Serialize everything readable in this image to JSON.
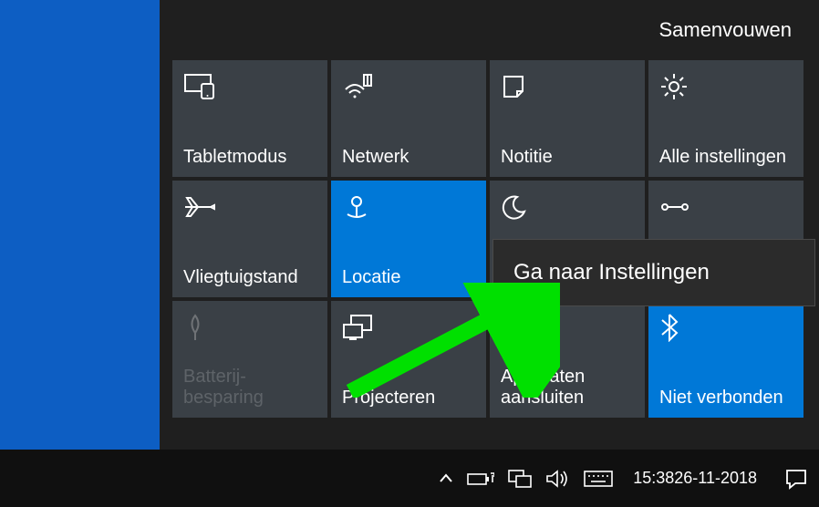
{
  "collapse_label": "Samenvouwen",
  "context_menu": {
    "label": "Ga naar Instellingen"
  },
  "tiles": {
    "tablet": {
      "label": "Tabletmodus"
    },
    "network": {
      "label": "Netwerk"
    },
    "note": {
      "label": "Notitie"
    },
    "settings": {
      "label": "Alle instellingen"
    },
    "airplane": {
      "label": "Vliegtuigstand"
    },
    "location": {
      "label": "Locatie"
    },
    "quiet": {
      "label": "Stille uren"
    },
    "vpn": {
      "label": "VPN"
    },
    "battery": {
      "label": "Batterij-\nbesparing"
    },
    "project": {
      "label": "Projecteren"
    },
    "connect": {
      "label": "Apparaten aansluiten"
    },
    "bluetooth": {
      "label": "Niet verbonden"
    }
  },
  "clock": {
    "time": "15:38",
    "date": "26-11-2018"
  }
}
